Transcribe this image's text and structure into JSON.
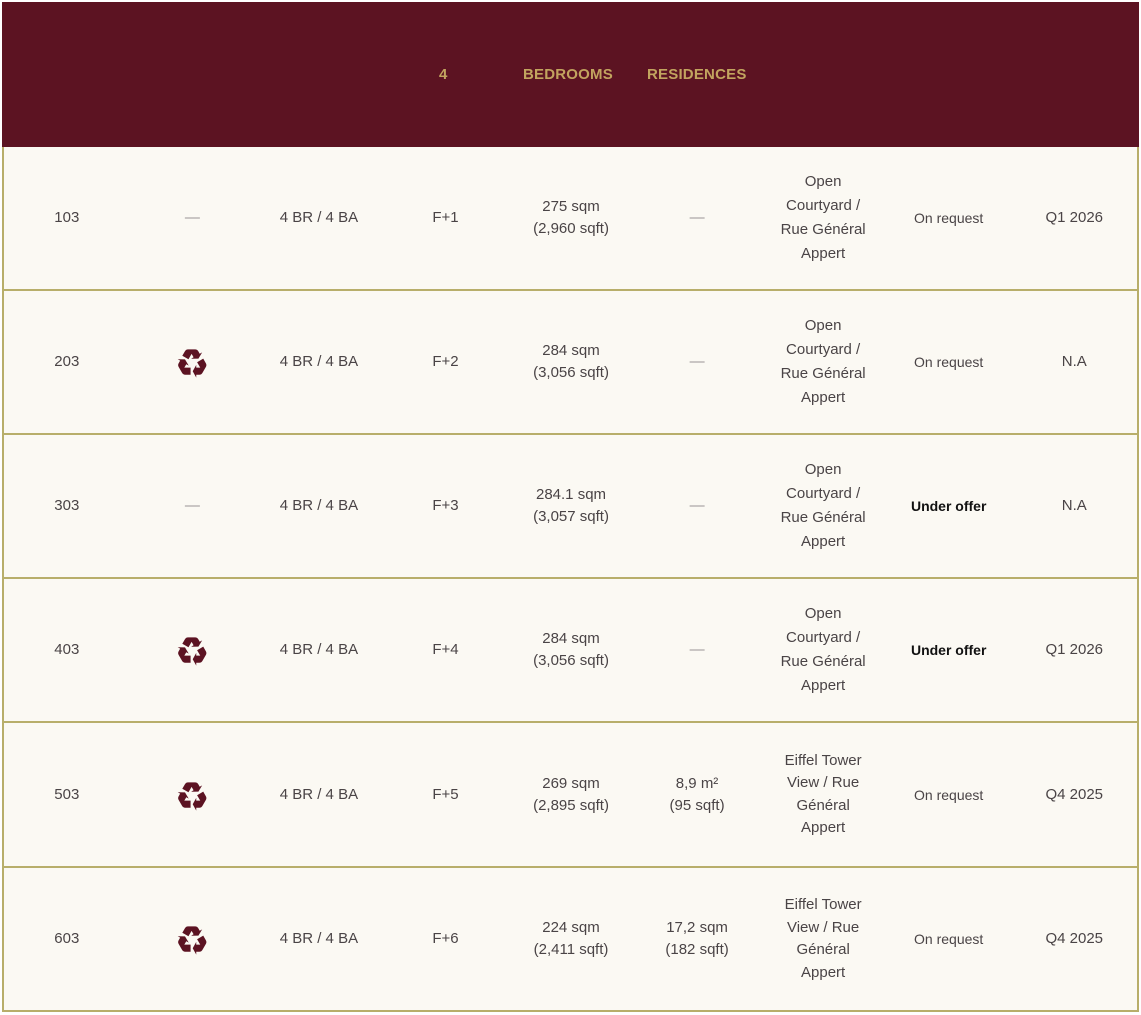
{
  "header": {
    "count": "4",
    "bedrooms_label": "BEDROOMS",
    "residences_label": "RESIDENCES"
  },
  "colors": {
    "header_bg": "#5c1322",
    "header_text": "#c2a45f",
    "table_bg": "#fbf9f3",
    "border": "#b8ae6a",
    "icon": "#5c1322"
  },
  "rows": [
    {
      "unit": "103",
      "feature": "—",
      "feature_icon": null,
      "layout": "4 BR / 4 BA",
      "floor": "F+1",
      "area": "275 sqm\n(2,960 sqft)",
      "outdoor": "—",
      "orientation": "Open\nCourtyard /\nRue Général\nAppert",
      "price": "On request",
      "delivery": "Q1 2026"
    },
    {
      "unit": "203",
      "feature": "",
      "feature_icon": "recycle-icon",
      "layout": "4 BR / 4 BA",
      "floor": "F+2",
      "area": "284 sqm\n(3,056 sqft)",
      "outdoor": "—",
      "orientation": "Open\nCourtyard /\nRue Général\nAppert",
      "price": "On request",
      "delivery": "N.A"
    },
    {
      "unit": "303",
      "feature": "—",
      "feature_icon": null,
      "layout": "4 BR / 4 BA",
      "floor": "F+3",
      "area": "284.1 sqm\n(3,057 sqft)",
      "outdoor": "—",
      "orientation": "Open\nCourtyard /\nRue Général\nAppert",
      "price": "Under offer",
      "delivery": "N.A"
    },
    {
      "unit": "403",
      "feature": "",
      "feature_icon": "recycle-icon",
      "layout": "4 BR / 4 BA",
      "floor": "F+4",
      "area": "284 sqm\n(3,056 sqft)",
      "outdoor": "—",
      "orientation": "Open\nCourtyard /\nRue Général\nAppert",
      "price": "Under offer",
      "delivery": "Q1 2026"
    },
    {
      "unit": "503",
      "feature": "",
      "feature_icon": "recycle-icon",
      "layout": "4 BR / 4 BA",
      "floor": "F+5",
      "area": "269 sqm\n(2,895 sqft)",
      "outdoor": "8,9 m²\n(95 sqft)",
      "orientation": "Eiffel Tower\nView / Rue\nGénéral\nAppert",
      "price": "On request",
      "delivery": "Q4 2025"
    },
    {
      "unit": "603",
      "feature": "",
      "feature_icon": "recycle-icon",
      "layout": "4 BR / 4 BA",
      "floor": "F+6",
      "area": "224 sqm\n(2,411 sqft)",
      "outdoor": "17,2 sqm\n(182 sqft)",
      "orientation": "Eiffel Tower\nView / Rue\nGénéral\nAppert",
      "price": "On request",
      "delivery": "Q4 2025"
    }
  ]
}
